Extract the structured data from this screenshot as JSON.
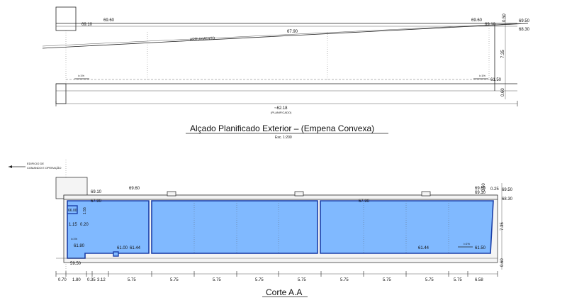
{
  "elevation": {
    "title": "Alçado Planificado Exterior – (Empena Convexa)",
    "scale": "Esc. 1:200",
    "level_left_top": "69.10",
    "level_left_upper": "69.60",
    "level_mid": "67.90",
    "road_label": "ARRUAMENTO",
    "level_right_a": "69.60",
    "level_right_b": "69.10",
    "level_right_c": "69.50",
    "level_right_d": "68.30",
    "level_right_bottom": "61.50",
    "slope_left": "i=1%",
    "slope_right": "i=1%",
    "dim_right_top": "0.50",
    "dim_right_mid": "7.35",
    "dim_right_bottom": "0.60",
    "length_label": "~62.18",
    "length_sub": "(PLANIFICADO)"
  },
  "section": {
    "title": "Corte A.A",
    "building_label_line1": "EDIFICIO DE",
    "building_label_line2": "COMANDO E OPERAÇÃO",
    "level_left_top": "69.10",
    "level_left_upper": "69.60",
    "level_left_water": "67.90",
    "level_mid_water": "67.90",
    "level_right_a": "69.60",
    "level_right_b": "69.10",
    "level_right_c": "69.50",
    "level_right_d": "68.30",
    "level_small_box": "66.00",
    "dim_155": "1.55",
    "dim_115": "1.15",
    "dim_020": "0.20",
    "slope_left": "i=1%",
    "level_6180": "61.80",
    "level_6150_left": "59.50",
    "level_6100": "61.00",
    "level_6144_left": "61.44",
    "level_6144_right": "61.44",
    "slope_right": "i=1%",
    "level_6150_right": "61.50",
    "dim_right_top": "0.50",
    "dim_right_025": "0.25",
    "dim_right_mid": "7.35",
    "dim_right_bottom": "0.60",
    "bottom_dims": [
      "0.70",
      "1.80",
      "0.35",
      "3.12",
      "5.75",
      "5.75",
      "5.75",
      "5.75",
      "5.75",
      "5.75",
      "5.75",
      "5.75",
      "5.75",
      "6.58"
    ]
  }
}
